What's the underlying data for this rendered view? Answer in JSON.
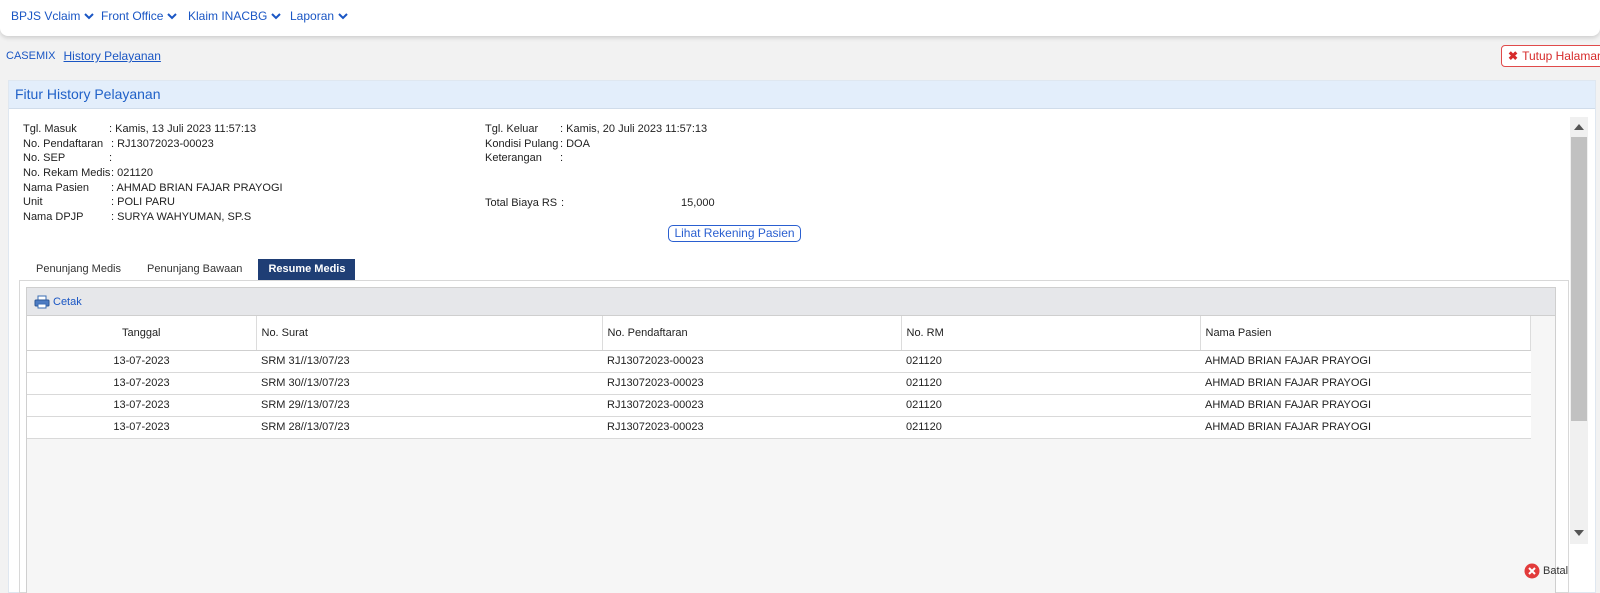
{
  "nav": {
    "items": [
      {
        "label": "BPJS Vclaim"
      },
      {
        "label": "Front Office"
      },
      {
        "label": "Klaim INACBG"
      },
      {
        "label": "Laporan"
      }
    ]
  },
  "breadcrumb": {
    "parent": "CASEMIX",
    "current": "History Pelayanan"
  },
  "close_page_label": "Tutup Halaman",
  "panel_title": "Fitur History Pelayanan",
  "left_info": [
    {
      "label": "Tgl. Masuk",
      "value": ": Kamis, 13 Juli 2023 11:57:13"
    },
    {
      "label": "No. Pendaftaran",
      "value": ": RJ13072023-00023"
    },
    {
      "label": "No. SEP",
      "value": ":"
    },
    {
      "label": "No. Rekam Medis",
      "value": ": 021120"
    },
    {
      "label": "Nama Pasien",
      "value": ": AHMAD BRIAN FAJAR PRAYOGI"
    },
    {
      "label": "Unit",
      "value": ": POLI PARU"
    },
    {
      "label": "Nama DPJP",
      "value": ": SURYA WAHYUMAN, SP.S"
    }
  ],
  "right_info": [
    {
      "label": "Tgl. Keluar",
      "value": ": Kamis, 20 Juli 2023 11:57:13"
    },
    {
      "label": "Kondisi Pulang",
      "value": ": DOA"
    },
    {
      "label": "Keterangan",
      "value": ":"
    }
  ],
  "total": {
    "label": "Total Biaya RS",
    "sep": ":",
    "value": "15,000"
  },
  "rekening_button": "Lihat Rekening Pasien",
  "tabs": [
    {
      "label": "Penunjang Medis",
      "active": false
    },
    {
      "label": "Penunjang Bawaan",
      "active": false
    },
    {
      "label": "Resume Medis",
      "active": true
    }
  ],
  "toolbar": {
    "print_label": "Cetak"
  },
  "table": {
    "columns": [
      "Tanggal",
      "No. Surat",
      "No. Pendaftaran",
      "No. RM",
      "Nama Pasien"
    ],
    "rows": [
      [
        "13-07-2023",
        "SRM 31//13/07/23",
        "RJ13072023-00023",
        "021120",
        "AHMAD BRIAN FAJAR PRAYOGI"
      ],
      [
        "13-07-2023",
        "SRM 30//13/07/23",
        "RJ13072023-00023",
        "021120",
        "AHMAD BRIAN FAJAR PRAYOGI"
      ],
      [
        "13-07-2023",
        "SRM 29//13/07/23",
        "RJ13072023-00023",
        "021120",
        "AHMAD BRIAN FAJAR PRAYOGI"
      ],
      [
        "13-07-2023",
        "SRM 28//13/07/23",
        "RJ13072023-00023",
        "021120",
        "AHMAD BRIAN FAJAR PRAYOGI"
      ]
    ]
  },
  "cancel_label": "Batal",
  "colors": {
    "accent": "#1a56c4",
    "tab_active": "#1f3e75",
    "close": "#d62b2b"
  }
}
